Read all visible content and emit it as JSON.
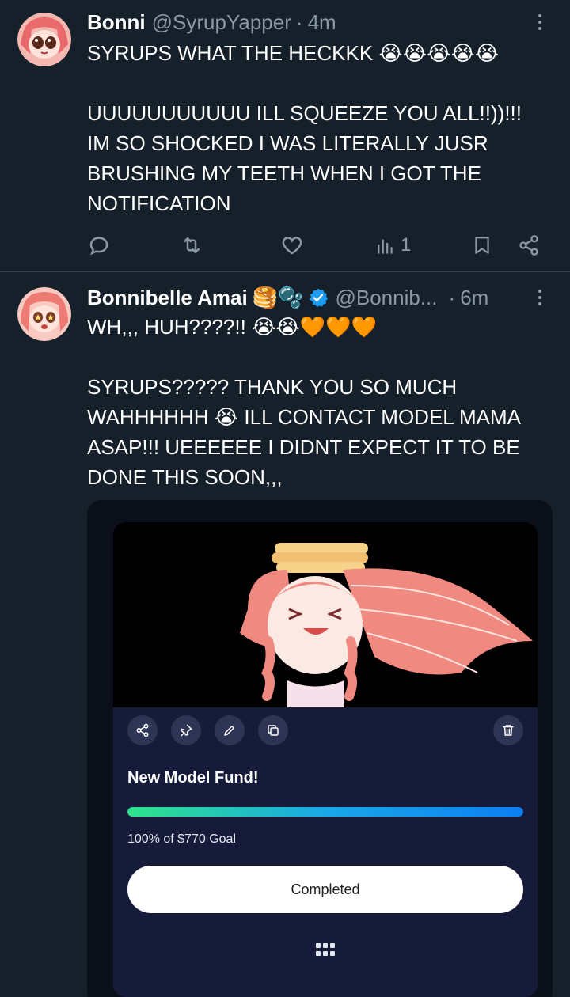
{
  "tweets": [
    {
      "name": "Bonni",
      "handle": "@SyrupYapper",
      "separator": "·",
      "time": "4m",
      "text": "SYRUPS WHAT THE HECKKK 😭😭😭😭😭\n\nUUUUUUUUUUU ILL SQUEEZE YOU ALL!!))!!!\nIM SO SHOCKED I WAS LITERALLY JUSR\nBRUSHING MY TEETH WHEN I GOT THE\nNOTIFICATION",
      "views_count": "1",
      "icons": [
        "reply-icon",
        "retweet-icon",
        "like-icon",
        "views-icon",
        "bookmark-icon",
        "share-icon"
      ]
    },
    {
      "name": "Bonnibelle Amai",
      "name_emojis": "🥞🫧",
      "handle": "@Bonnib...",
      "separator": "·",
      "time": "6m",
      "text": "WH,,, HUH????!! 😭😭🧡🧡🧡\n\nSYRUPS????? THANK YOU SO MUCH\nWAHHHHHH 😭 ILL CONTACT MODEL MAMA\nASAP!!! UEEEEEE I DIDNT EXPECT IT TO BE\nDONE THIS SOON,,,",
      "verified_color": "#1d9bf0"
    }
  ],
  "fund_card": {
    "title": "New Model Fund!",
    "goal_text": "100% of $770 Goal",
    "progress_percent": 100,
    "button_label": "Completed",
    "toolbar_icons": [
      "share-icon",
      "pin-icon",
      "edit-icon",
      "copy-icon",
      "delete-icon"
    ]
  },
  "colors": {
    "background": "#15202b",
    "muted": "#8b98a5",
    "card": "#161b3a",
    "accent_blue": "#1d9bf0"
  }
}
